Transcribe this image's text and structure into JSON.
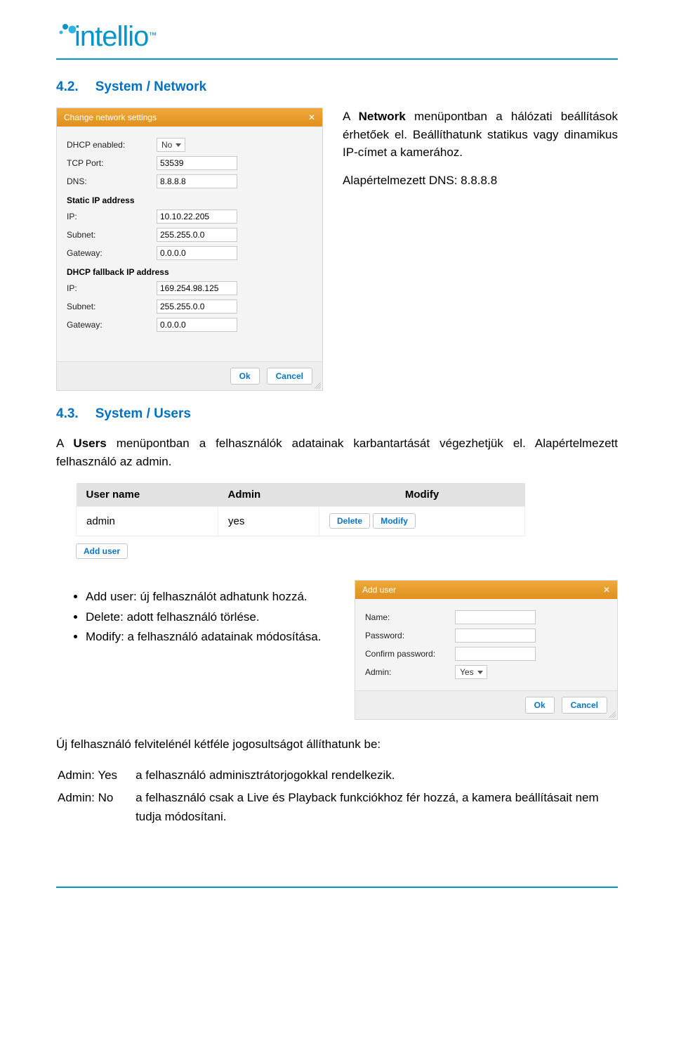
{
  "logo": {
    "text": "intellio",
    "tm": "™"
  },
  "section1": {
    "num": "4.2.",
    "title": "System / Network",
    "para1_a": "A ",
    "para1_b": "Network",
    "para1_c": " menüpontban a hálózati beállítások érhetőek el. Beállíthatunk statikus vagy dinamikus IP-címet a kamerához.",
    "para2": "Alapértelmezett DNS: 8.8.8.8"
  },
  "dialog_network": {
    "title": "Change network settings",
    "fields": {
      "dhcp_label": "DHCP enabled:",
      "dhcp_value": "No",
      "tcp_label": "TCP Port:",
      "tcp_value": "53539",
      "dns_label": "DNS:",
      "dns_value": "8.8.8.8",
      "static_head": "Static IP address",
      "ip1_label": "IP:",
      "ip1_value": "10.10.22.205",
      "sub1_label": "Subnet:",
      "sub1_value": "255.255.0.0",
      "gw1_label": "Gateway:",
      "gw1_value": "0.0.0.0",
      "fallback_head": "DHCP fallback IP address",
      "ip2_label": "IP:",
      "ip2_value": "169.254.98.125",
      "sub2_label": "Subnet:",
      "sub2_value": "255.255.0.0",
      "gw2_label": "Gateway:",
      "gw2_value": "0.0.0.0",
      "ok": "Ok",
      "cancel": "Cancel"
    }
  },
  "section2": {
    "num": "4.3.",
    "title": "System / Users",
    "para1_a": "A ",
    "para1_b": "Users",
    "para1_c": " menüpontban a felhasználók adatainak karbantartását végezhetjük el. Alapértelmezett felhasználó az admin."
  },
  "users_table": {
    "head": {
      "c1": "User name",
      "c2": "Admin",
      "c3": "Modify"
    },
    "row": {
      "c1": "admin",
      "c2": "yes",
      "delete": "Delete",
      "modify": "Modify"
    },
    "add": "Add user"
  },
  "bullets": {
    "b1": "Add user: új felhasználót adhatunk hozzá.",
    "b2": "Delete: adott felhasználó törlése.",
    "b3": "Modify: a felhasználó adatainak módosítása."
  },
  "dialog_adduser": {
    "title": "Add user",
    "name_label": "Name:",
    "pw_label": "Password:",
    "cpw_label": "Confirm password:",
    "admin_label": "Admin:",
    "admin_value": "Yes",
    "ok": "Ok",
    "cancel": "Cancel"
  },
  "para_new": "Új felhasználó felvitelénél kétféle jogosultságot állíthatunk be:",
  "admin_rows": {
    "r1a": "Admin: Yes",
    "r1b": "a felhasználó adminisztrátorjogokkal rendelkezik.",
    "r2a": "Admin: No",
    "r2b": "a felhasználó csak a Live és Playback funkciókhoz fér hozzá, a kamera beállításait nem tudja módosítani."
  }
}
